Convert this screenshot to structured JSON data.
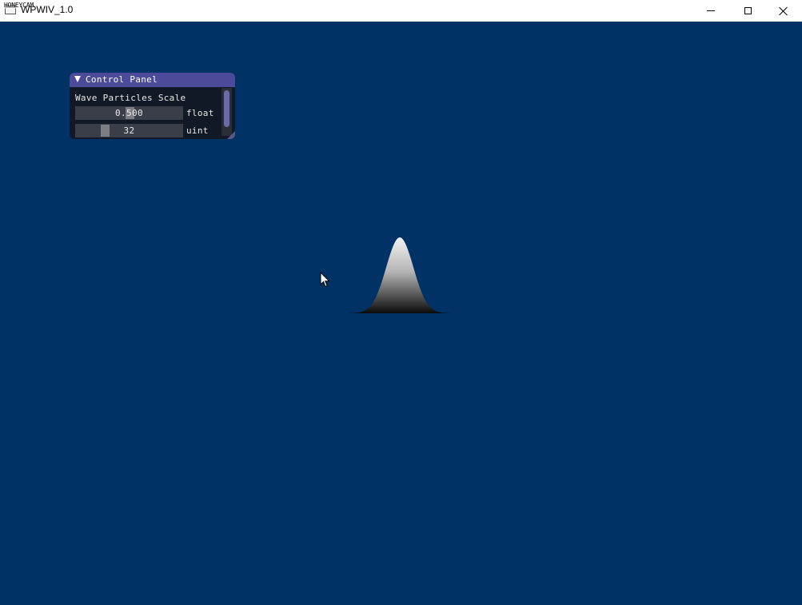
{
  "window": {
    "title": "WPWIV_1.0",
    "watermark": "HONEYCAM",
    "controls": {
      "minimize": "minimize-icon",
      "maximize": "maximize-icon",
      "close": "close-icon"
    }
  },
  "colors": {
    "viewport_bg": "#003265",
    "panel_header": "#4b4b99",
    "panel_bg": "#14161e",
    "slider_bg": "#3a3e48",
    "slider_grab": "#7d7d85"
  },
  "control_panel": {
    "title": "Control Panel",
    "section_label": "Wave Particles Scale",
    "sliders": [
      {
        "value": "0.500",
        "type": "float",
        "level": 0.5
      },
      {
        "value": "32",
        "type": "uint",
        "level": 0.25
      }
    ]
  }
}
